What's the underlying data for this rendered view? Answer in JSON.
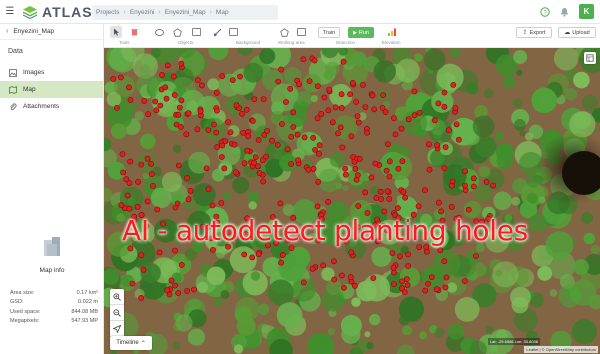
{
  "app": {
    "name": "ATLAS"
  },
  "breadcrumb": [
    "Projects",
    "Enyezini",
    "Enyezini_Map",
    "Map"
  ],
  "avatar": {
    "initial": "K",
    "color": "#4caf50"
  },
  "sidebar": {
    "project_name": "Enyezini_Map",
    "section_label": "Data",
    "items": [
      {
        "label": "Images",
        "icon": "image-icon",
        "active": false
      },
      {
        "label": "Map",
        "icon": "map-icon",
        "active": true
      },
      {
        "label": "Attachments",
        "icon": "paperclip-icon",
        "active": false
      }
    ],
    "map_info_label": "Map info",
    "stats": [
      {
        "label": "Area size:",
        "value": "0.17 km²"
      },
      {
        "label": "GSD:",
        "value": "0.022 m"
      },
      {
        "label": "Used space:",
        "value": "844.08 MB"
      },
      {
        "label": "Megapixels:",
        "value": "547.93 MP"
      }
    ]
  },
  "toolbar": {
    "groups": {
      "tools": "Tools",
      "objects": "Objects",
      "background": "Background",
      "working_area": "Working area",
      "detection": "Detection",
      "elevation": "Elevation"
    },
    "train_label": "Train",
    "run_label": "Run",
    "export_label": "Export",
    "upload_label": "Upload"
  },
  "map": {
    "overlay_text": "AI - autodetect planting holes",
    "timeline_label": "Timeline",
    "coords": "Lat: -29.6566 Lon: 30.8036",
    "attribution": "Leaflet | © OpenStreetMap contributors",
    "detection_color": "#e02020"
  }
}
